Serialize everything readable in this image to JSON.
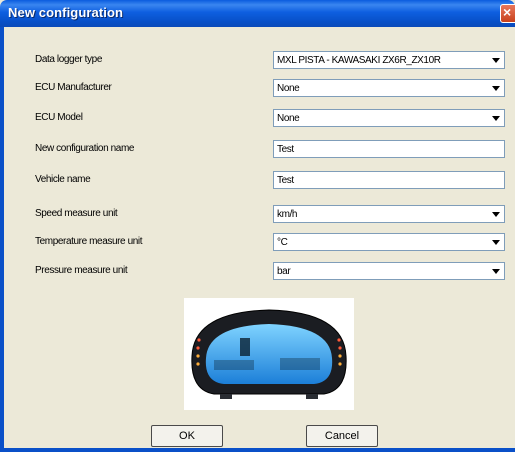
{
  "window": {
    "title": "New configuration"
  },
  "fields": [
    {
      "label": "Data logger type",
      "value": "MXL PISTA - KAWASAKI ZX6R_ZX10R",
      "kind": "combo"
    },
    {
      "label": "ECU Manufacturer",
      "value": "None",
      "kind": "combo"
    },
    {
      "label": "ECU Model",
      "value": "None",
      "kind": "combo"
    },
    {
      "label": "New configuration name",
      "value": "Test",
      "kind": "text"
    },
    {
      "label": "Vehicle name",
      "value": "Test",
      "kind": "text"
    },
    {
      "label": "Speed measure unit",
      "value": "km/h",
      "kind": "combo"
    },
    {
      "label": "Temperature measure unit",
      "value": "°C",
      "kind": "combo"
    },
    {
      "label": "Pressure measure unit",
      "value": "bar",
      "kind": "combo"
    }
  ],
  "buttons": {
    "ok": "OK",
    "cancel": "Cancel"
  },
  "icons": {
    "close": "close-icon",
    "dropdown": "chevron-down-icon"
  },
  "colors": {
    "titlebar": "#0a5cde",
    "dialog_bg": "#ece9d8",
    "field_border": "#7f9db9"
  }
}
